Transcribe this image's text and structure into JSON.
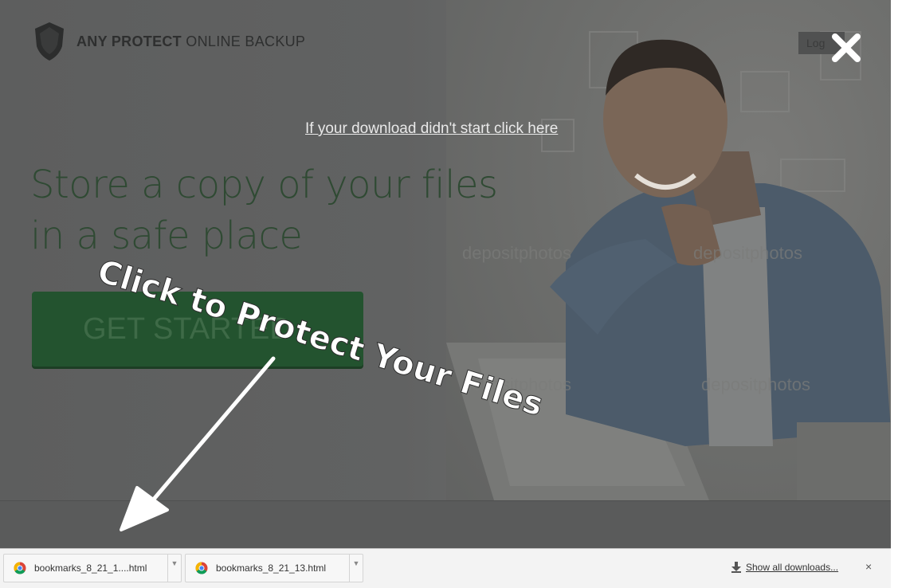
{
  "brand": {
    "name_bold": "ANY PROTECT",
    "name_rest": " ONLINE BACKUP"
  },
  "header": {
    "login_label": "Log"
  },
  "download_link": "If your download didn't start click here",
  "headline": {
    "line1": "Store a copy of your files",
    "line2": "in a safe place"
  },
  "cta_label": "GET STARTED",
  "annotation": "Click to Protect Your Files",
  "watermarks": [
    "depositphotos",
    "depositphotos",
    "depositphotos",
    "depositphotos"
  ],
  "downloads": {
    "items": [
      {
        "name": "bookmarks_8_21_1....html",
        "icon": "chrome-icon"
      },
      {
        "name": "bookmarks_8_21_13.html",
        "icon": "chrome-icon"
      }
    ],
    "show_all": "Show all downloads...",
    "close": "×"
  },
  "colors": {
    "overlay": "#5f6060",
    "cta_green": "#23532f",
    "headline_green": "#2f4a33"
  }
}
